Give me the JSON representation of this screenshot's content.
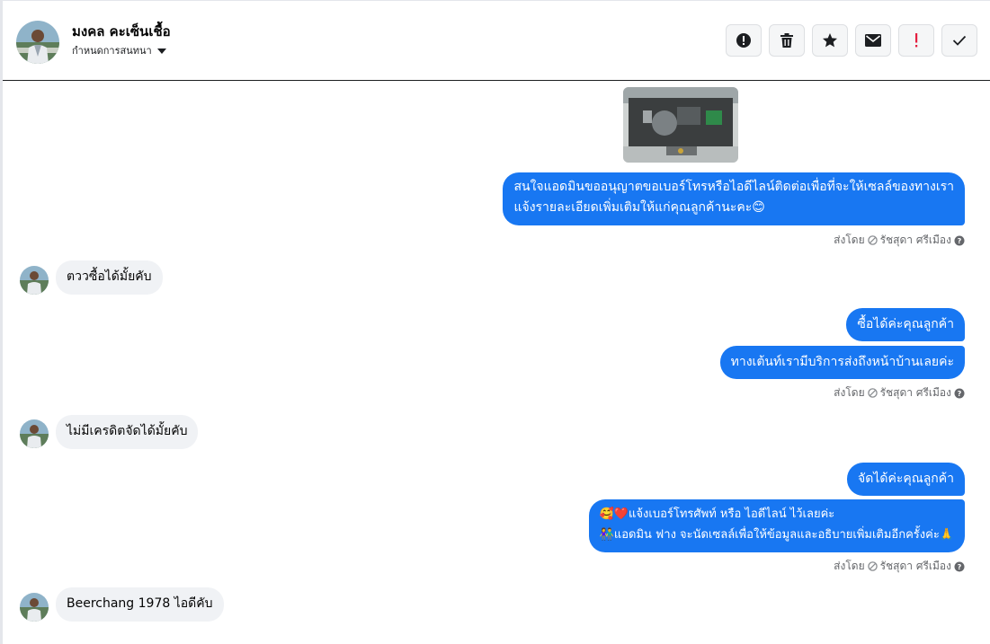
{
  "contact": {
    "name": "มงคล คะเซ็นเชื้อ",
    "subtitle": "กำหนดการสนทนา"
  },
  "toolbar": {
    "buttons": [
      {
        "icon": "alert-circle-icon",
        "name": "mark-important-button"
      },
      {
        "icon": "trash-icon",
        "name": "delete-button"
      },
      {
        "icon": "star-icon",
        "name": "star-button"
      },
      {
        "icon": "envelope-icon",
        "name": "mark-unread-button"
      },
      {
        "icon": "exclamation-icon",
        "name": "spam-button"
      },
      {
        "icon": "check-icon",
        "name": "done-button"
      }
    ]
  },
  "messages": {
    "m1_line1": "สนใจแอดมินขออนุญาตขอเบอร์โทรหรือไอดีไลน์ติดต่อเพื่อที่จะให้เซลล์ของทางเรา",
    "m1_line2": "แจ้งรายละเอียดเพิ่มเติมให้แก่คุณลูกค้านะคะ😊",
    "in1": "ตววซื้อได้มั้ยคับ",
    "m2": "ซื้อได้ค่ะคุณลูกค้า",
    "m3": "ทางเต้นท์เรามีบริการส่งถึงหน้าบ้านเลยค่ะ",
    "in2": "ไม่มีเครดิตจัดได้มั้ยคับ",
    "m4": "จัดได้ค่ะคุณลูกค้า",
    "m5_line1": "🥰❤️แจ้งเบอร์โทรศัพท์ หรือ ไอดีไลน์  ไว้เลยค่ะ",
    "m5_line2": "👫แอดมิน ฟาง จะนัดเซลล์เพื่อให้ข้อมูลและอธิบายเพิ่มเติมอีกครั้งค่ะ🙏",
    "in3": "Beerchang 1978 ไอดีคับ"
  },
  "sent_by": {
    "prefix": "ส่งโดย",
    "agent": "รัชสุดา ศรีเมือง"
  },
  "colors": {
    "outgoing": "#1877f2",
    "incoming": "#f0f2f5",
    "muted": "#65676b"
  }
}
